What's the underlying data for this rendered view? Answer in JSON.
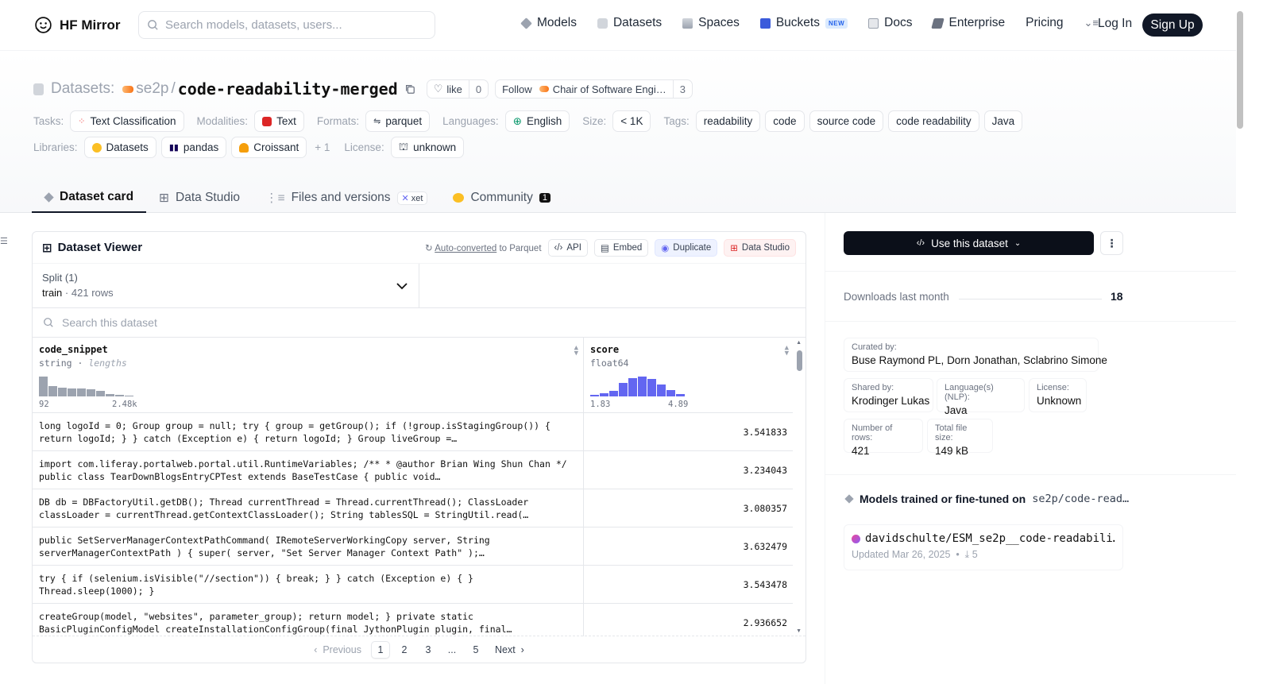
{
  "nav": {
    "brand": "HF Mirror",
    "search_placeholder": "Search models, datasets, users...",
    "links": [
      "Models",
      "Datasets",
      "Spaces",
      "Buckets",
      "Docs",
      "Enterprise",
      "Pricing"
    ],
    "new_badge": "NEW",
    "login": "Log In",
    "signup": "Sign Up"
  },
  "header": {
    "datasets_label": "Datasets:",
    "owner": "se2p",
    "separator": "/",
    "repo": "code-readability-merged",
    "like_label": "like",
    "like_count": "0",
    "follow_label": "Follow",
    "org_name": "Chair of Software Engi…",
    "follow_count": "3"
  },
  "meta": {
    "tasks_label": "Tasks:",
    "task": "Text Classification",
    "modalities_label": "Modalities:",
    "modality": "Text",
    "formats_label": "Formats:",
    "format": "parquet",
    "languages_label": "Languages:",
    "language": "English",
    "size_label": "Size:",
    "size": "< 1K",
    "tags_label": "Tags:",
    "tags": [
      "readability",
      "code",
      "source code",
      "code readability",
      "Java"
    ],
    "libraries_label": "Libraries:",
    "libraries": [
      "Datasets",
      "pandas",
      "Croissant"
    ],
    "libraries_more": "+ 1",
    "license_label": "License:",
    "license": "unknown"
  },
  "tabs": {
    "card": "Dataset card",
    "studio": "Data Studio",
    "files": "Files and versions",
    "xet": "xet",
    "community": "Community",
    "community_count": "1"
  },
  "viewer": {
    "title": "Dataset Viewer",
    "auto_converted": "Auto-converted",
    "to_parquet": "to Parquet",
    "api": "API",
    "embed": "Embed",
    "duplicate": "Duplicate",
    "data_studio": "Data Studio",
    "split_label": "Split (1)",
    "split_name": "train",
    "split_rows": "421 rows",
    "search_placeholder": "Search this dataset",
    "col1": {
      "name": "code_snippet",
      "type": "string",
      "sub": "lengths",
      "min": "92",
      "max": "2.48k"
    },
    "col2": {
      "name": "score",
      "type": "float64",
      "min": "1.83",
      "max": "4.89"
    },
    "rows": [
      {
        "code": "long logoId = 0; Group group = null; try { group = getGroup(); if (!group.isStagingGroup()) { return logoId; } } catch (Exception e) { return logoId; } Group liveGroup =…",
        "score": "3.541833"
      },
      {
        "code": "import com.liferay.portalweb.portal.util.RuntimeVariables; /** * @author Brian Wing Shun Chan */ public class TearDownBlogsEntryCPTest extends BaseTestCase { public void…",
        "score": "3.234043"
      },
      {
        "code": "DB db = DBFactoryUtil.getDB(); Thread currentThread = Thread.currentThread(); ClassLoader classLoader = currentThread.getContextClassLoader(); String tablesSQL = StringUtil.read(…",
        "score": "3.080357"
      },
      {
        "code": "public SetServerManagerContextPathCommand( IRemoteServerWorkingCopy server, String serverManagerContextPath ) { super( server, \"Set Server Manager Context Path\" );…",
        "score": "3.632479"
      },
      {
        "code": "try { if (selenium.isVisible(\"//section\")) { break; } } catch (Exception e) { } Thread.sleep(1000); }",
        "score": "3.543478"
      },
      {
        "code": "createGroup(model, \"websites\", parameter_group); return model; } private static BasicPluginConfigModel createInstallationConfigGroup(final JythonPlugin plugin, final…",
        "score": "2.936652"
      }
    ],
    "pager": {
      "prev": "Previous",
      "pages": [
        "1",
        "2",
        "3",
        "...",
        "5"
      ],
      "next": "Next"
    }
  },
  "sidebar": {
    "use_button": "Use this dataset",
    "downloads_label": "Downloads last month",
    "downloads_value": "18",
    "curated_by_label": "Curated by:",
    "curated_by": "Buse Raymond PL, Dorn Jonathan, Sclabrino Simone",
    "shared_by_label": "Shared by:",
    "shared_by": "Krodinger Lukas",
    "language_nlp_label": "Language(s) (NLP):",
    "language_nlp": "Java",
    "license_label": "License:",
    "license": "Unknown",
    "rows_label": "Number of rows:",
    "rows": "421",
    "filesize_label": "Total file size:",
    "filesize": "149 kB",
    "models_title": "Models trained or fine-tuned on",
    "models_repo": "se2p/code-read…",
    "model_name": "davidschulte/ESM_se2p__code-readabili…",
    "model_updated": "Updated Mar 26, 2025",
    "model_downloads": "5"
  }
}
